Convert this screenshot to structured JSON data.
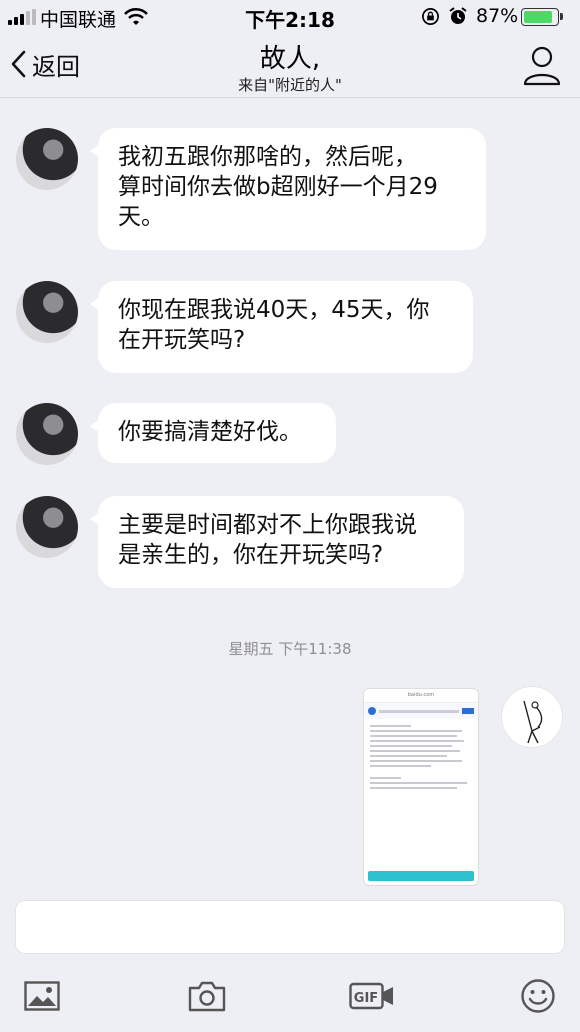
{
  "status_bar": {
    "carrier": "中国联通",
    "time": "下午2:18",
    "battery_percent": "87%",
    "battery_level": 0.87,
    "icons": [
      "signal-icon",
      "wifi-icon",
      "orientation-lock-icon",
      "alarm-icon",
      "battery-icon"
    ]
  },
  "nav": {
    "back_label": "返回",
    "title": "故人,",
    "subtitle": "来自\"附近的人\""
  },
  "messages": [
    {
      "sender": "other",
      "text": "我初五跟你那啥的，然后呢，\n算时间你去做b超刚好一个月29\n天。"
    },
    {
      "sender": "other",
      "text": "你现在跟我说40天，45天，你\n在开玩笑吗?"
    },
    {
      "sender": "other",
      "text": "你要搞清楚好伐。"
    },
    {
      "sender": "other",
      "text": "主要是时间都对不上你跟我说\n是亲生的，你在开玩笑吗?"
    }
  ],
  "timestamp": "星期五 下午11:38",
  "image_message": {
    "url": "baidu.com"
  },
  "colors": {
    "background": "#eeeff4",
    "bubble": "#ffffff",
    "battery": "#4cd964"
  }
}
